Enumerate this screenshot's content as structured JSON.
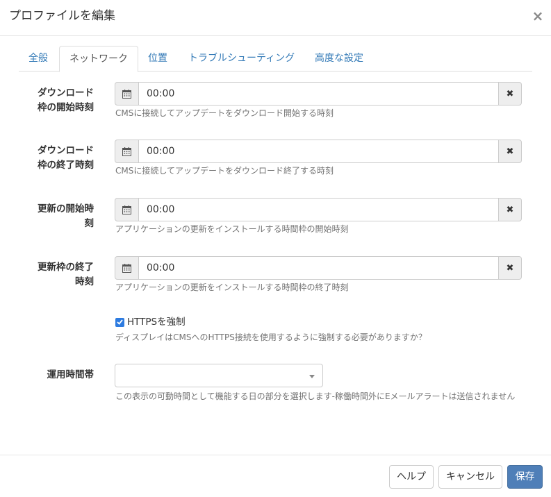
{
  "dialog": {
    "title": "プロファイルを編集",
    "close_label": "×"
  },
  "tabs": [
    {
      "label": "全般",
      "active": false
    },
    {
      "label": "ネットワーク",
      "active": true
    },
    {
      "label": "位置",
      "active": false
    },
    {
      "label": "トラブルシューティング",
      "active": false
    },
    {
      "label": "高度な設定",
      "active": false
    }
  ],
  "fields": [
    {
      "label_line1": "ダウンロード",
      "label_line2": "枠の開始時刻",
      "value": "00:00",
      "help": "CMSに接続してアップデートをダウンロード開始する時刻"
    },
    {
      "label_line1": "ダウンロード",
      "label_line2": "枠の終了時刻",
      "value": "00:00",
      "help": "CMSに接続してアップデートをダウンロード終了する時刻"
    },
    {
      "label_line1": "更新の開始時",
      "label_line2": "刻",
      "value": "00:00",
      "help": "アプリケーションの更新をインストールする時間枠の開始時刻"
    },
    {
      "label_line1": "更新枠の終了",
      "label_line2": "時刻",
      "value": "00:00",
      "help": "アプリケーションの更新をインストールする時間枠の終了時刻"
    }
  ],
  "https": {
    "checked": true,
    "label": "HTTPSを強制",
    "help": "ディスプレイはCMSへのHTTPS接続を使用するように強制する必要がありますか？"
  },
  "operating_hours": {
    "label": "運用時間帯",
    "value": "",
    "help": "この表示の可動時間として機能する日の部分を選択します-稼働時間外にEメールアラートは送信されません"
  },
  "footer": {
    "help_label": "ヘルプ",
    "cancel_label": "キャンセル",
    "save_label": "保存"
  },
  "colors": {
    "link": "#337ab7",
    "primary": "#4f7fb8",
    "checkbox": "#2d7be0"
  },
  "icons": {
    "addon": "calendar-icon",
    "clear": "times-icon",
    "close": "close-icon",
    "select": "caret-down-icon"
  }
}
